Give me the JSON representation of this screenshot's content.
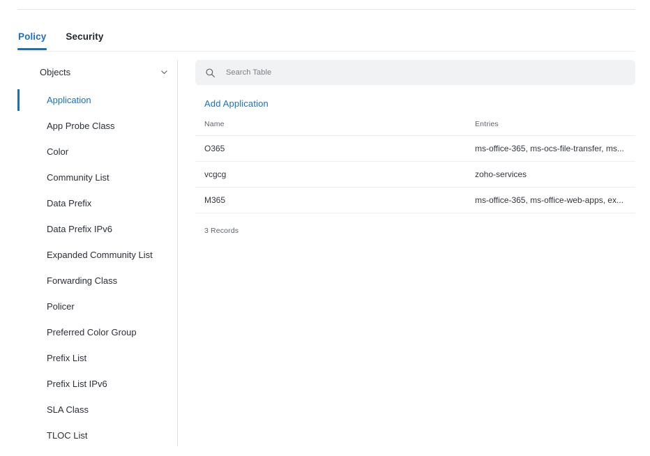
{
  "theme": {
    "accent": "#1a6fc4",
    "text": "#2b3037",
    "muted": "#5e646c",
    "divider": "#e4e8ed",
    "search_bg": "#f1f2f4"
  },
  "tabs": [
    {
      "label": "Policy",
      "active": true
    },
    {
      "label": "Security",
      "active": false
    }
  ],
  "sidebar": {
    "group": {
      "label": "Objects",
      "icon": "chevron-down-icon",
      "expanded": true
    },
    "items": [
      {
        "label": "Application",
        "active": true
      },
      {
        "label": "App Probe Class",
        "active": false
      },
      {
        "label": "Color",
        "active": false
      },
      {
        "label": "Community List",
        "active": false
      },
      {
        "label": "Data Prefix",
        "active": false
      },
      {
        "label": "Data Prefix IPv6",
        "active": false
      },
      {
        "label": "Expanded Community List",
        "active": false
      },
      {
        "label": "Forwarding Class",
        "active": false
      },
      {
        "label": "Policer",
        "active": false
      },
      {
        "label": "Preferred Color Group",
        "active": false
      },
      {
        "label": "Prefix List",
        "active": false
      },
      {
        "label": "Prefix List IPv6",
        "active": false
      },
      {
        "label": "SLA Class",
        "active": false
      },
      {
        "label": "TLOC List",
        "active": false
      }
    ]
  },
  "search": {
    "icon": "search-icon",
    "placeholder": "Search Table",
    "value": ""
  },
  "actions": {
    "add_label": "Add Application"
  },
  "table": {
    "columns": [
      "Name",
      "Entries"
    ],
    "rows": [
      {
        "name": "O365",
        "entries": "ms-office-365, ms-ocs-file-transfer, ms..."
      },
      {
        "name": "vcgcg",
        "entries": "zoho-services"
      },
      {
        "name": "M365",
        "entries": "ms-office-365, ms-office-web-apps, ex..."
      }
    ],
    "footer": "3 Records"
  }
}
